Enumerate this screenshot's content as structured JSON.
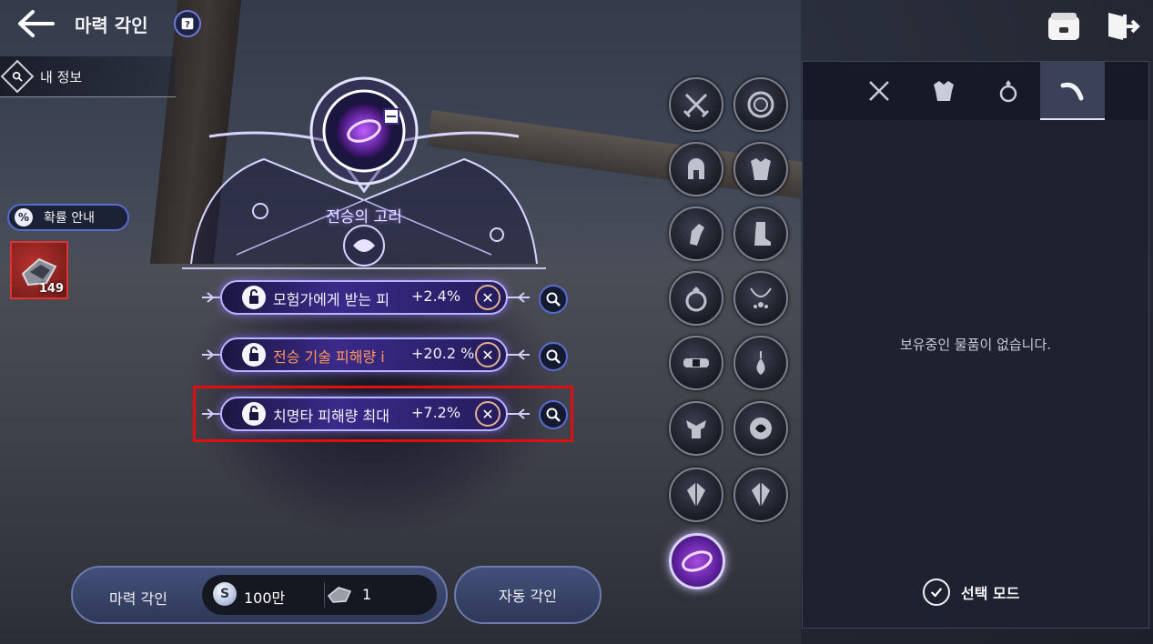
{
  "header": {
    "title": "마력 각인",
    "back_icon": "arrow-left-icon",
    "help_icon": "question-book-icon",
    "bag_icon": "bag-icon",
    "exit_icon": "exit-icon"
  },
  "sidebar": {
    "my_info_label": "내 정보",
    "probability_label": "확률 안내",
    "probability_icon_text": "%",
    "material_count": "149"
  },
  "engraving": {
    "item_name": "전승의 고리",
    "options": [
      {
        "text": "모험가에게 받는 피",
        "value": "+2.4%",
        "highlight": false,
        "color": "#f4f2ff"
      },
      {
        "text": "전승 기술 피해량 i",
        "value": "+20.2 %",
        "highlight": false,
        "color": "#ff9a5a"
      },
      {
        "text": "치명타 피해량 최대",
        "value": "+7.2%",
        "highlight": true,
        "color": "#f4f2ff"
      }
    ]
  },
  "bottom": {
    "engrave_label": "마력 각인",
    "coin_symbol": "S",
    "coin_cost": "100만",
    "stone_cost": "1",
    "auto_label": "자동 각인"
  },
  "panel": {
    "tabs": [
      "swords-icon",
      "armor-icon",
      "ring-icon",
      "curve-icon"
    ],
    "active_tab": 3,
    "empty_message": "보유중인 물품이 없습니다.",
    "select_mode_label": "선택 모드"
  },
  "colors": {
    "accent": "#5a6bd0",
    "highlight": "#e01010",
    "orange_text": "#ff9a5a"
  }
}
